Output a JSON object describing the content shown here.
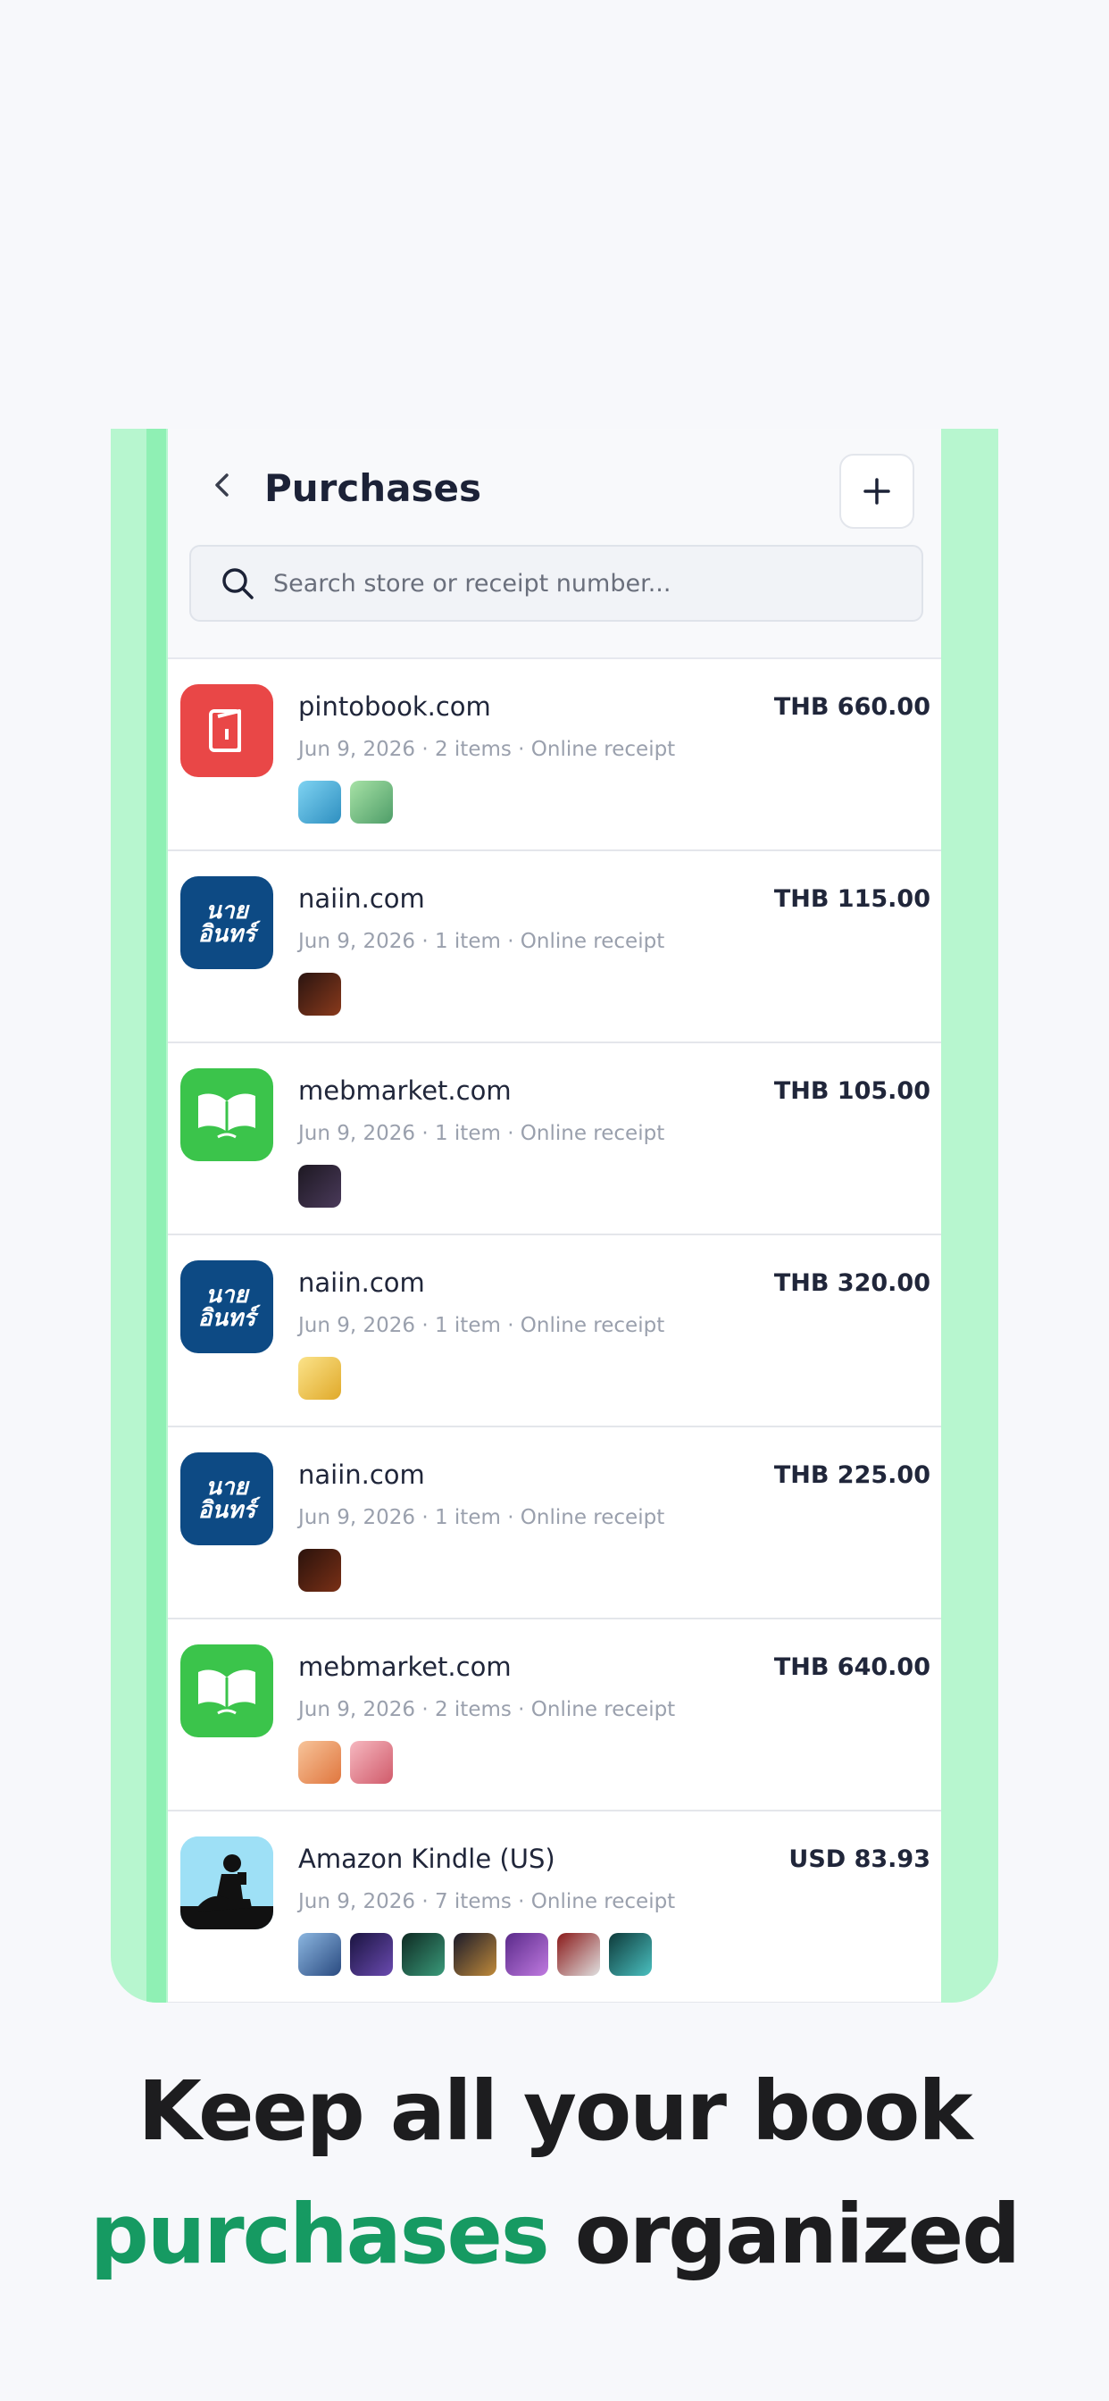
{
  "header": {
    "title": "Purchases"
  },
  "search": {
    "placeholder": "Search store or receipt number..."
  },
  "purchases": [
    {
      "store": "pintobook.com",
      "amount": "THB 660.00",
      "meta": "Jun 9, 2026 · 2 items · Online receipt",
      "logo": "pintobook-logo",
      "thumbs": [
        "#4bb6e0",
        "#7cc98b"
      ]
    },
    {
      "store": "naiin.com",
      "amount": "THB 115.00",
      "meta": "Jun 9, 2026 · 1 item · Online receipt",
      "logo": "naiin-logo",
      "logo_text": "นายอินทร์",
      "thumbs": [
        "#5a2a1a"
      ]
    },
    {
      "store": "mebmarket.com",
      "amount": "THB 105.00",
      "meta": "Jun 9, 2026 · 1 item · Online receipt",
      "logo": "meb-logo",
      "thumbs": [
        "#2c2433"
      ]
    },
    {
      "store": "naiin.com",
      "amount": "THB 320.00",
      "meta": "Jun 9, 2026 · 1 item · Online receipt",
      "logo": "naiin-logo",
      "logo_text": "นายอินทร์",
      "thumbs": [
        "#f2c84a"
      ]
    },
    {
      "store": "naiin.com",
      "amount": "THB 225.00",
      "meta": "Jun 9, 2026 · 1 item · Online receipt",
      "logo": "naiin-logo",
      "logo_text": "นายอินทร์",
      "thumbs": [
        "#4a2218"
      ]
    },
    {
      "store": "mebmarket.com",
      "amount": "THB 640.00",
      "meta": "Jun 9, 2026 · 2 items · Online receipt",
      "logo": "meb-logo",
      "thumbs": [
        "#f0a070",
        "#e98f9c"
      ]
    },
    {
      "store": "Amazon Kindle (US)",
      "amount": "USD 83.93",
      "meta": "Jun 9, 2026 · 7 items · Online receipt",
      "logo": "kindle-logo",
      "thumbs": [
        "#4b7bb0",
        "#3a2a6a",
        "#1f5a4a",
        "#2a2a4a",
        "#7a4aa0",
        "#b0302a",
        "#2a8a8a"
      ]
    }
  ],
  "headline": {
    "line1": "Keep all your book",
    "line2_green": "purchases",
    "line2_rest": " organized"
  },
  "colors": {
    "accent_green": "#169a62",
    "frame_green": "#b7f6cf",
    "pinto_red": "#e94747",
    "naiin_blue": "#0d4a84",
    "meb_green": "#3bc44b"
  }
}
